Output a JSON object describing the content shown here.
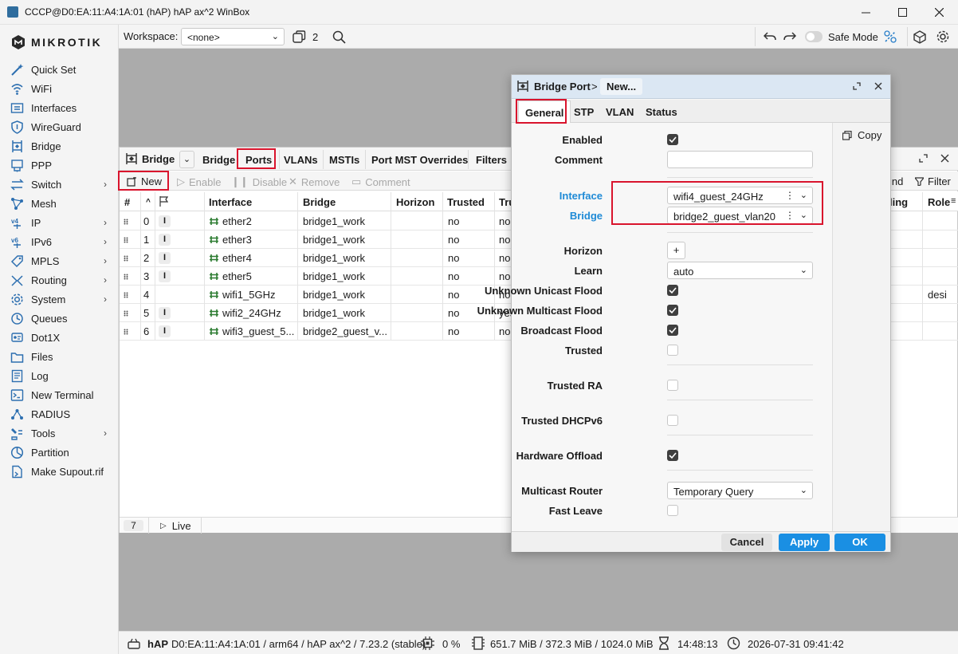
{
  "window": {
    "title": "CCCP@D0:EA:11:A4:1A:01 (hAP) hAP ax^2 WinBox"
  },
  "brand": {
    "logo_text": "MIKROTIK"
  },
  "sidebar": {
    "items": [
      {
        "label": "Quick Set",
        "icon": "wand-icon"
      },
      {
        "label": "WiFi",
        "icon": "wifi-icon"
      },
      {
        "label": "Interfaces",
        "icon": "interfaces-icon"
      },
      {
        "label": "WireGuard",
        "icon": "shield-icon"
      },
      {
        "label": "Bridge",
        "icon": "bridge-icon"
      },
      {
        "label": "PPP",
        "icon": "ppp-icon"
      },
      {
        "label": "Switch",
        "icon": "switch-icon",
        "arrow": "›"
      },
      {
        "label": "Mesh",
        "icon": "mesh-icon"
      },
      {
        "label": "IP",
        "icon": "ip-icon",
        "arrow": "›"
      },
      {
        "label": "IPv6",
        "icon": "ipv6-icon",
        "arrow": "›"
      },
      {
        "label": "MPLS",
        "icon": "tag-icon",
        "arrow": "›"
      },
      {
        "label": "Routing",
        "icon": "routing-icon",
        "arrow": "›"
      },
      {
        "label": "System",
        "icon": "gear-icon",
        "arrow": "›"
      },
      {
        "label": "Queues",
        "icon": "queues-icon"
      },
      {
        "label": "Dot1X",
        "icon": "dot1x-icon"
      },
      {
        "label": "Files",
        "icon": "files-icon"
      },
      {
        "label": "Log",
        "icon": "log-icon"
      },
      {
        "label": "New Terminal",
        "icon": "terminal-icon"
      },
      {
        "label": "RADIUS",
        "icon": "radius-icon"
      },
      {
        "label": "Tools",
        "icon": "tools-icon",
        "arrow": "›"
      },
      {
        "label": "Partition",
        "icon": "partition-icon"
      },
      {
        "label": "Make Supout.rif",
        "icon": "supout-icon"
      }
    ]
  },
  "toolbar": {
    "workspace_label": "Workspace:",
    "workspace_value": "<none>",
    "windows_count": "2",
    "safe_mode_label": "Safe Mode"
  },
  "bridge_window": {
    "title": "Bridge",
    "tabs": [
      "Bridge",
      "Ports",
      "VLANs",
      "MSTIs",
      "Port MST Overrides",
      "Filters"
    ],
    "actions": {
      "new": "New",
      "enable": "Enable",
      "disable": "Disable",
      "remove": "Remove",
      "comment": "Comment",
      "find": "ind",
      "filter": "Filter"
    },
    "columns": {
      "num": "#",
      "interface": "Interface",
      "bridge": "Bridge",
      "horizon": "Horizon",
      "trusted": "Trusted",
      "tru": "Tru",
      "role_prefix": "ling",
      "role": "Role"
    },
    "rows": [
      {
        "num": "0",
        "flag": "I",
        "interface": "ether2",
        "bridge": "bridge1_work",
        "trusted": "no",
        "tru": "no",
        "role": ""
      },
      {
        "num": "1",
        "flag": "I",
        "interface": "ether3",
        "bridge": "bridge1_work",
        "trusted": "no",
        "tru": "no",
        "role": ""
      },
      {
        "num": "2",
        "flag": "I",
        "interface": "ether4",
        "bridge": "bridge1_work",
        "trusted": "no",
        "tru": "no",
        "role": ""
      },
      {
        "num": "3",
        "flag": "I",
        "interface": "ether5",
        "bridge": "bridge1_work",
        "trusted": "no",
        "tru": "no",
        "role": ""
      },
      {
        "num": "4",
        "flag": "",
        "interface": "wifi1_5GHz",
        "bridge": "bridge1_work",
        "trusted": "no",
        "tru": "no",
        "role": "desi"
      },
      {
        "num": "5",
        "flag": "I",
        "interface": "wifi2_24GHz",
        "bridge": "bridge1_work",
        "trusted": "no",
        "tru": "yes",
        "role": ""
      },
      {
        "num": "6",
        "flag": "I",
        "interface": "wifi3_guest_5...",
        "bridge": "bridge2_guest_v...",
        "trusted": "no",
        "tru": "no",
        "role": ""
      }
    ],
    "footer": {
      "count": "7",
      "live": "Live"
    }
  },
  "dialog": {
    "crumb_root": "Bridge Port",
    "crumb_sep": ">",
    "crumb_current": "New...",
    "tabs": [
      "General",
      "STP",
      "VLAN",
      "Status"
    ],
    "copy_label": "Copy",
    "fields": {
      "enabled": {
        "label": "Enabled",
        "checked": true
      },
      "comment": {
        "label": "Comment",
        "value": ""
      },
      "interface": {
        "label": "Interface",
        "value": "wifi4_guest_24GHz"
      },
      "bridge": {
        "label": "Bridge",
        "value": "bridge2_guest_vlan20"
      },
      "horizon": {
        "label": "Horizon",
        "value": "+"
      },
      "learn": {
        "label": "Learn",
        "value": "auto"
      },
      "unknown_unicast_flood": {
        "label": "Unknown Unicast Flood",
        "checked": true
      },
      "unknown_multicast_flood": {
        "label": "Unknown Multicast Flood",
        "checked": true
      },
      "broadcast_flood": {
        "label": "Broadcast Flood",
        "checked": true
      },
      "trusted": {
        "label": "Trusted",
        "checked": false
      },
      "trusted_ra": {
        "label": "Trusted RA",
        "checked": false
      },
      "trusted_dhcpv6": {
        "label": "Trusted DHCPv6",
        "checked": false
      },
      "hardware_offload": {
        "label": "Hardware Offload",
        "checked": true
      },
      "multicast_router": {
        "label": "Multicast Router",
        "value": "Temporary Query"
      },
      "fast_leave": {
        "label": "Fast Leave",
        "checked": false
      }
    },
    "buttons": {
      "cancel": "Cancel",
      "apply": "Apply",
      "ok": "OK"
    }
  },
  "statusbar": {
    "device": "hAP",
    "info": "D0:EA:11:A4:1A:01 / arm64 / hAP ax^2 / 7.23.2 (stable)",
    "cpu": "0 %",
    "memory": "651.7 MiB / 372.3 MiB / 1024.0 MiB",
    "uptime": "14:48:13",
    "datetime": "2026-07-31 09:41:42"
  },
  "colors": {
    "accent": "#1a8fe3",
    "highlight": "#d9142d",
    "link_label": "#1e8ad6",
    "dialog_title_bg": "#dbe7f3",
    "checkbox_on": "#3f3f3f",
    "green_icon": "#2e7d32"
  }
}
